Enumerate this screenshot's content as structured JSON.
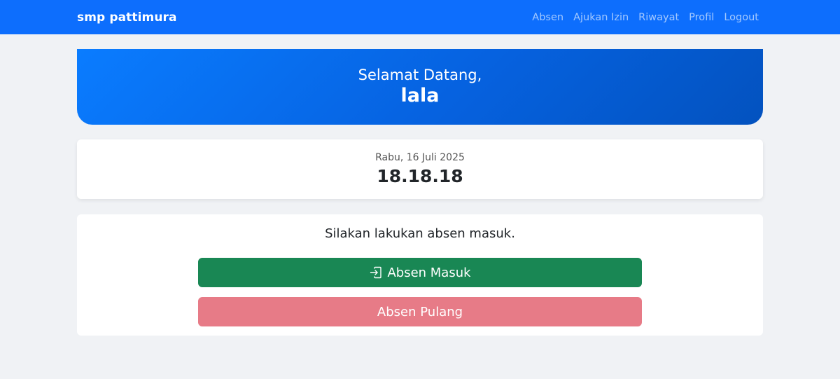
{
  "navbar": {
    "brand": "smp pattimura",
    "links": [
      "Absen",
      "Ajukan Izin",
      "Riwayat",
      "Profil",
      "Logout"
    ]
  },
  "welcome": {
    "greeting": "Selamat Datang,",
    "name": "lala"
  },
  "clock": {
    "date": "Rabu, 16 Juli 2025",
    "time": "18.18.18"
  },
  "attendance": {
    "message": "Silakan lakukan absen masuk.",
    "check_in_label": "Absen Masuk",
    "check_in_icon": "box-arrow-in-icon",
    "check_out_label": "Absen Pulang"
  },
  "colors": {
    "primary": "#0d6efd",
    "success": "#198754",
    "danger_disabled": "#e77b87"
  }
}
